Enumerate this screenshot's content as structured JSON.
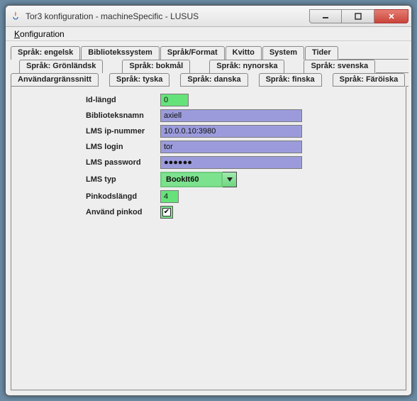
{
  "window": {
    "title": "Tor3 konfiguration - machineSpecific - LUSUS"
  },
  "menu": {
    "konfiguration": "Konfiguration"
  },
  "tabs": {
    "row1": [
      "Språk: engelsk",
      "Bibliotekssystem",
      "Språk/Format",
      "Kvitto",
      "System",
      "Tider"
    ],
    "row2": [
      "Språk: Grönländsk",
      "Språk: bokmål",
      "Språk: nynorska",
      "Språk: svenska"
    ],
    "row3": [
      "Användargränssnitt",
      "Språk: tyska",
      "Språk: danska",
      "Språk: finska",
      "Språk: Färöiska"
    ],
    "selected": "Bibliotekssystem"
  },
  "form": {
    "id_langd": {
      "label": "Id-längd",
      "value": "0"
    },
    "biblioteksnamn": {
      "label": "Biblioteksnamn",
      "value": "axiell"
    },
    "lms_ip": {
      "label": "LMS ip-nummer",
      "value": "10.0.0.10:3980"
    },
    "lms_login": {
      "label": "LMS login",
      "value": "tor"
    },
    "lms_password": {
      "label": "LMS password",
      "value": "●●●●●●"
    },
    "lms_typ": {
      "label": "LMS typ",
      "value": "BookIt60"
    },
    "pinkodslangd": {
      "label": "Pinkodslängd",
      "value": "4"
    },
    "anvand_pinkod": {
      "label": "Använd pinkod",
      "checked": true
    }
  }
}
